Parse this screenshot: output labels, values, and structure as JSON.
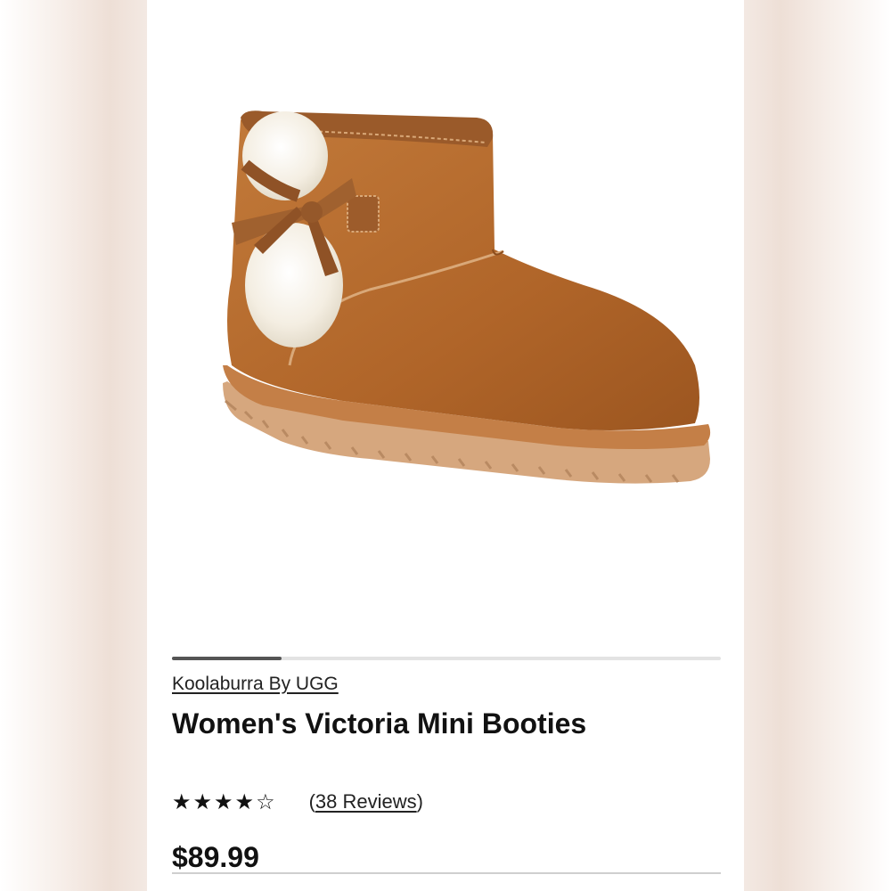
{
  "product": {
    "brand": "Koolaburra By UGG",
    "title": "Women's Victoria Mini Booties",
    "rating": 4,
    "rating_max": 5,
    "stars_text": "★★★★☆",
    "reviews_open": "(",
    "reviews_text": "38 Reviews",
    "reviews_close": ")",
    "price": "$89.99"
  },
  "carousel": {
    "progress_fraction": 0.2
  },
  "colors": {
    "suede": "#b5682c",
    "sole": "#d6a77e",
    "fur": "#f6f1e6"
  },
  "icons": {
    "star": "star-icon"
  }
}
